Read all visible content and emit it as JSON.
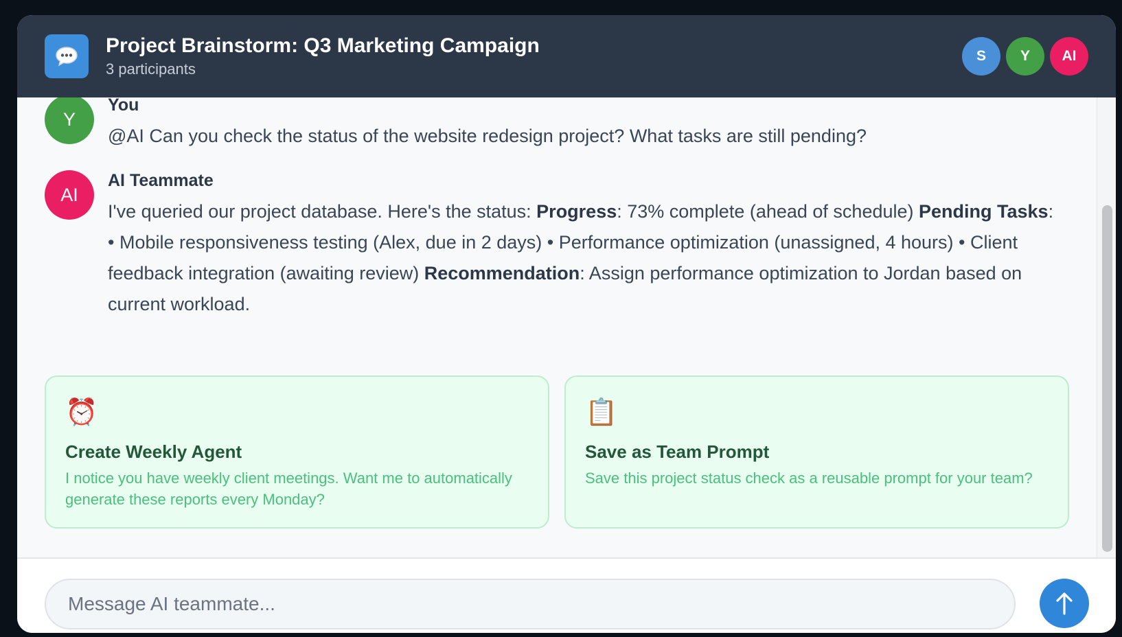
{
  "header": {
    "title": "Project Brainstorm: Q3 Marketing Campaign",
    "subtitle": "3 participants",
    "app_icon": "speech-bubble-icon",
    "participants": [
      {
        "initials": "S",
        "color": "#4a90d9"
      },
      {
        "initials": "Y",
        "color": "#43a047"
      },
      {
        "initials": "AI",
        "color": "#e91e63"
      }
    ]
  },
  "messages": [
    {
      "author": "You",
      "avatar": {
        "initials": "Y",
        "color": "#43a047"
      },
      "text": "@AI Can you check the status of the website redesign project? What tasks are still pending?"
    },
    {
      "author": "AI Teammate",
      "avatar": {
        "initials": "AI",
        "color": "#e91e63"
      },
      "segments": {
        "t1": "I've queried our project database. Here's the status: ",
        "b1": "Progress",
        "t2": ": 73% complete (ahead of schedule) ",
        "b2": "Pending Tasks",
        "t3": ": • Mobile responsiveness testing (Alex, due in 2 days) • Performance optimization (unassigned, 4 hours) • Client feedback integration (awaiting review) ",
        "b3": "Recommendation",
        "t4": ": Assign performance optimization to Jordan based on current workload."
      }
    }
  ],
  "suggestions": [
    {
      "icon": "⏰",
      "icon_name": "alarm-clock-icon",
      "title": "Create Weekly Agent",
      "description": "I notice you have weekly client meetings. Want me to automatically generate these reports every Monday?"
    },
    {
      "icon": "📋",
      "icon_name": "clipboard-icon",
      "title": "Save as Team Prompt",
      "description": "Save this project status check as a reusable prompt for your team?"
    }
  ],
  "composer": {
    "placeholder": "Message AI teammate...",
    "value": "",
    "send_icon": "arrow-up-icon"
  },
  "colors": {
    "header_bg": "#2c3848",
    "accent": "#3086d8",
    "suggestion_bg": "#eafdf1",
    "suggestion_title": "#22573a",
    "suggestion_text": "#48c07e"
  }
}
